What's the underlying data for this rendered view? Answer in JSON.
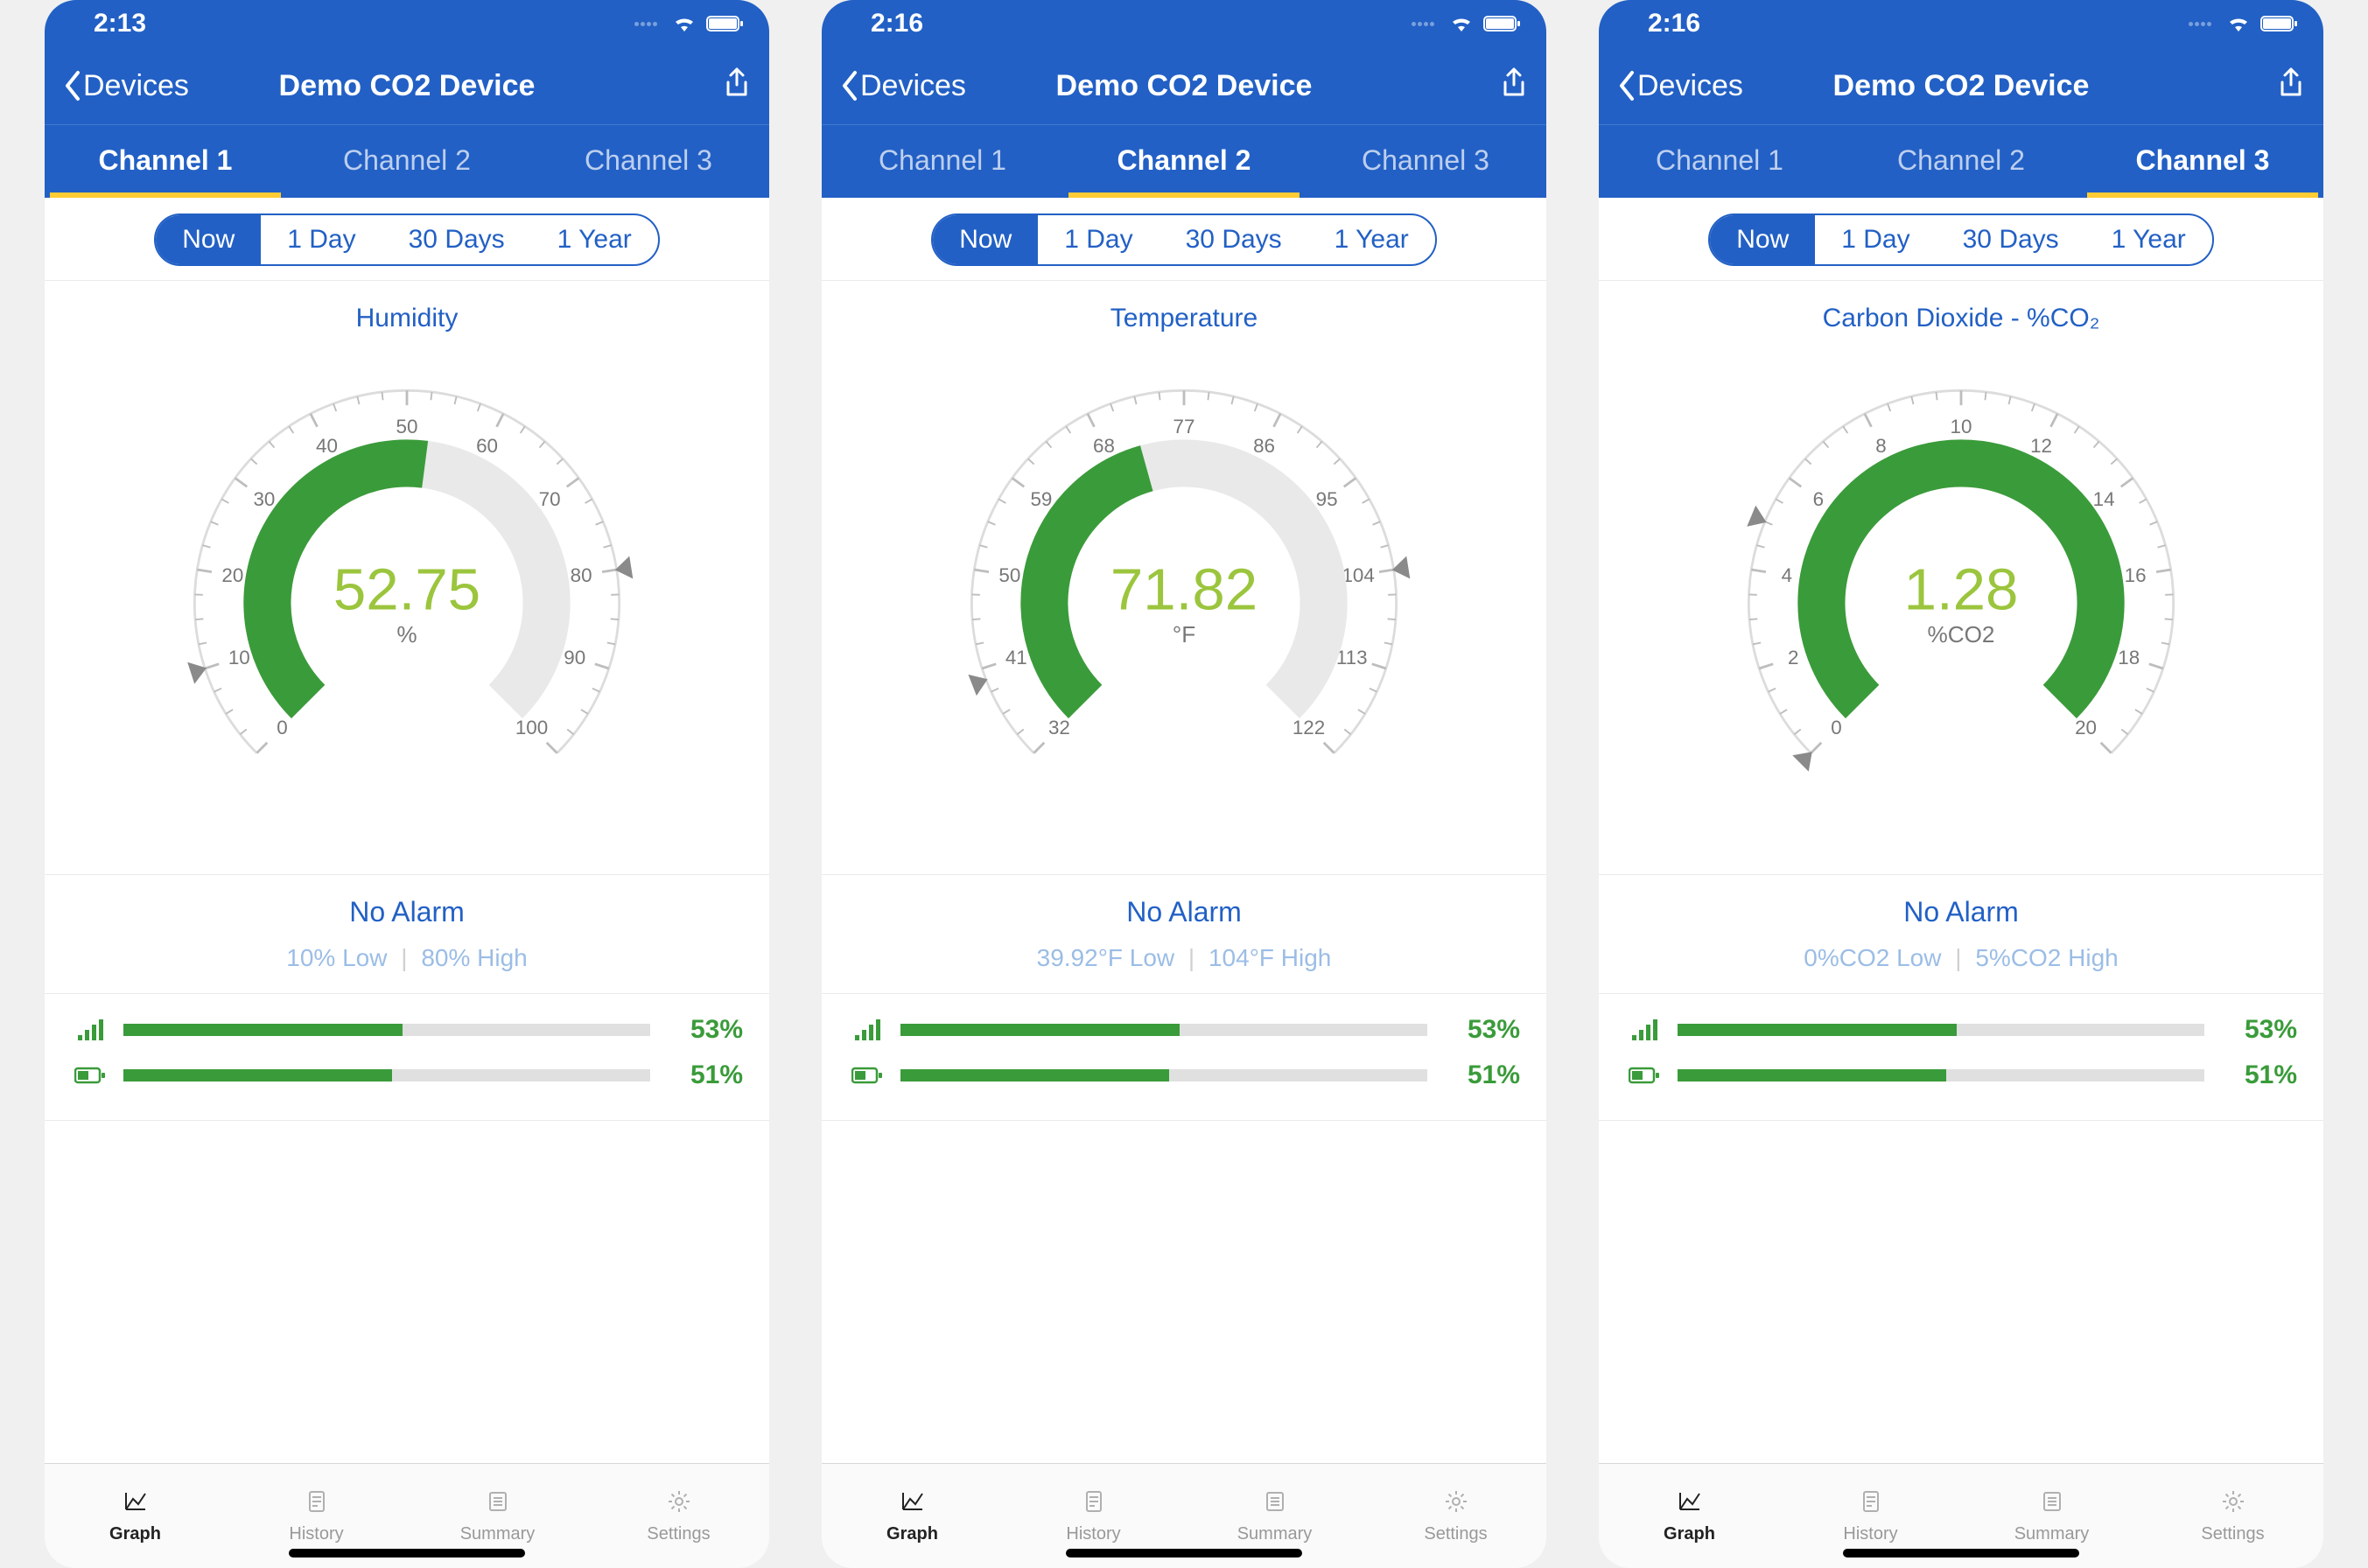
{
  "screens": [
    {
      "time": "2:13",
      "back_label": "Devices",
      "title": "Demo CO2 Device",
      "channels": [
        "Channel 1",
        "Channel 2",
        "Channel 3"
      ],
      "active_channel": 0,
      "segments": [
        "Now",
        "1 Day",
        "30 Days",
        "1 Year"
      ],
      "active_segment": 0,
      "gauge": {
        "label": "Humidity",
        "value": "52.75",
        "unit": "%",
        "min": 0,
        "max": 100,
        "fill_to": 52.75,
        "ticks": [
          0,
          10,
          20,
          30,
          40,
          50,
          60,
          70,
          80,
          90,
          100
        ],
        "low_marker": 10,
        "high_marker": 80
      },
      "alarm_status": "No Alarm",
      "alarm_low": "10% Low",
      "alarm_high": "80% High",
      "signal_pct": 53,
      "battery_pct": 51
    },
    {
      "time": "2:16",
      "back_label": "Devices",
      "title": "Demo CO2 Device",
      "channels": [
        "Channel 1",
        "Channel 2",
        "Channel 3"
      ],
      "active_channel": 1,
      "segments": [
        "Now",
        "1 Day",
        "30 Days",
        "1 Year"
      ],
      "active_segment": 0,
      "gauge": {
        "label": "Temperature",
        "value": "71.82",
        "unit": "°F",
        "min": 32,
        "max": 122,
        "fill_to": 71.82,
        "ticks": [
          32,
          41,
          50,
          59,
          68,
          77,
          86,
          95,
          104,
          113,
          122
        ],
        "low_marker": 39.92,
        "high_marker": 104
      },
      "alarm_status": "No Alarm",
      "alarm_low": "39.92°F Low",
      "alarm_high": "104°F High",
      "signal_pct": 53,
      "battery_pct": 51
    },
    {
      "time": "2:16",
      "back_label": "Devices",
      "title": "Demo CO2 Device",
      "channels": [
        "Channel 1",
        "Channel 2",
        "Channel 3"
      ],
      "active_channel": 2,
      "segments": [
        "Now",
        "1 Day",
        "30 Days",
        "1 Year"
      ],
      "active_segment": 0,
      "gauge": {
        "label": "Carbon Dioxide - %CO₂",
        "value": "1.28",
        "unit": "%CO2",
        "min": 0,
        "max": 20,
        "fill_to": 20,
        "ticks": [
          0,
          2,
          4,
          6,
          8,
          10,
          12,
          14,
          16,
          18,
          20
        ],
        "low_marker": 0,
        "high_marker": 5
      },
      "alarm_status": "No Alarm",
      "alarm_low": "0%CO2 Low",
      "alarm_high": "5%CO2 High",
      "signal_pct": 53,
      "battery_pct": 51
    }
  ],
  "bottom_tabs": [
    "Graph",
    "History",
    "Summary",
    "Settings"
  ],
  "active_bottom_tab": 0,
  "chart_data": [
    {
      "type": "gauge",
      "title": "Humidity",
      "min": 0,
      "max": 100,
      "value": 52.75,
      "unit": "%",
      "ticks": [
        0,
        10,
        20,
        30,
        40,
        50,
        60,
        70,
        80,
        90,
        100
      ],
      "low_alarm": 10,
      "high_alarm": 80
    },
    {
      "type": "gauge",
      "title": "Temperature",
      "min": 32,
      "max": 122,
      "value": 71.82,
      "unit": "°F",
      "ticks": [
        32,
        41,
        50,
        59,
        68,
        77,
        86,
        95,
        104,
        113,
        122
      ],
      "low_alarm": 39.92,
      "high_alarm": 104
    },
    {
      "type": "gauge",
      "title": "Carbon Dioxide - %CO₂",
      "min": 0,
      "max": 20,
      "value": 1.28,
      "unit": "%CO2",
      "ticks": [
        0,
        2,
        4,
        6,
        8,
        10,
        12,
        14,
        16,
        18,
        20
      ],
      "low_alarm": 0,
      "high_alarm": 5
    }
  ]
}
